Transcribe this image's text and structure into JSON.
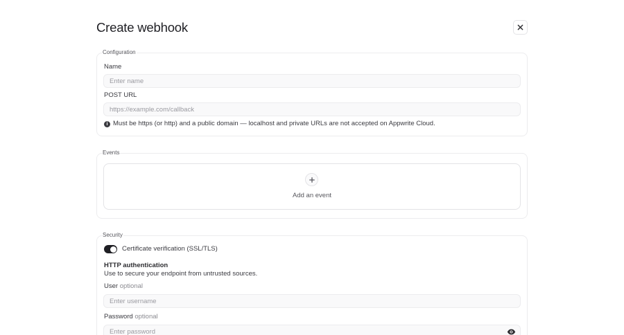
{
  "dialog": {
    "title": "Create webhook"
  },
  "configuration": {
    "legend": "Configuration",
    "name_label": "Name",
    "name_placeholder": "Enter name",
    "name_value": "",
    "url_label": "POST URL",
    "url_placeholder": "https://example.com/callback",
    "url_value": "",
    "url_helper": "Must be https (or http) and a public domain — localhost and private URLs are not accepted on Appwrite Cloud."
  },
  "events": {
    "legend": "Events",
    "add_label": "Add an event"
  },
  "security": {
    "legend": "Security",
    "ssl_label": "Certificate verification (SSL/TLS)",
    "ssl_enabled": true,
    "http_auth_title": "HTTP authentication",
    "http_auth_desc": "Use to secure your endpoint from untrusted sources.",
    "user_label": "User",
    "user_optional": "optional",
    "user_placeholder": "Enter username",
    "user_value": "",
    "password_label": "Password",
    "password_optional": "optional",
    "password_placeholder": "Enter password",
    "password_value": ""
  },
  "icons": {
    "close": "close-icon",
    "info": "info-icon",
    "add": "plus-icon",
    "toggle_password": "eye-icon"
  },
  "colors": {
    "text": "#2d2d31",
    "border": "#ececee",
    "input_bg": "#f9f9fa",
    "toggle_on": "#1f1f24"
  }
}
